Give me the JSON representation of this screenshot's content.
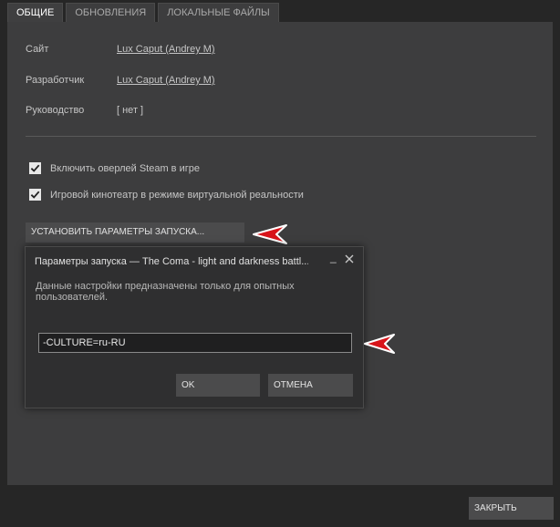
{
  "tabs": [
    {
      "label": "ОБЩИЕ"
    },
    {
      "label": "ОБНОВЛЕНИЯ"
    },
    {
      "label": "ЛОКАЛЬНЫЕ ФАЙЛЫ"
    }
  ],
  "general": {
    "site_label": "Сайт",
    "site_value": "Lux Caput (Andrey M)",
    "developer_label": "Разработчик",
    "developer_value": "Lux Caput (Andrey M)",
    "manual_label": "Руководство",
    "manual_value": "[ нет ]",
    "overlay_label": "Включить оверлей Steam в игре",
    "overlay_checked": true,
    "vr_label": "Игровой кинотеатр в режиме виртуальной реальности",
    "vr_checked": true,
    "launch_options_button": "УСТАНОВИТЬ ПАРАМЕТРЫ ЗАПУСКА..."
  },
  "dialog": {
    "title": "Параметры запуска — The Coma - light and darkness battl...",
    "description": "Данные настройки предназначены только для опытных пользователей.",
    "input_value": "-CULTURE=ru-RU",
    "ok_label": "OK",
    "cancel_label": "ОТМЕНА",
    "minimize_glyph": "_"
  },
  "footer": {
    "close_button": "ЗАКРЫТЬ"
  },
  "colors": {
    "arrow": "#d8141a",
    "panel": "#3d3d3e",
    "background": "#262626"
  }
}
